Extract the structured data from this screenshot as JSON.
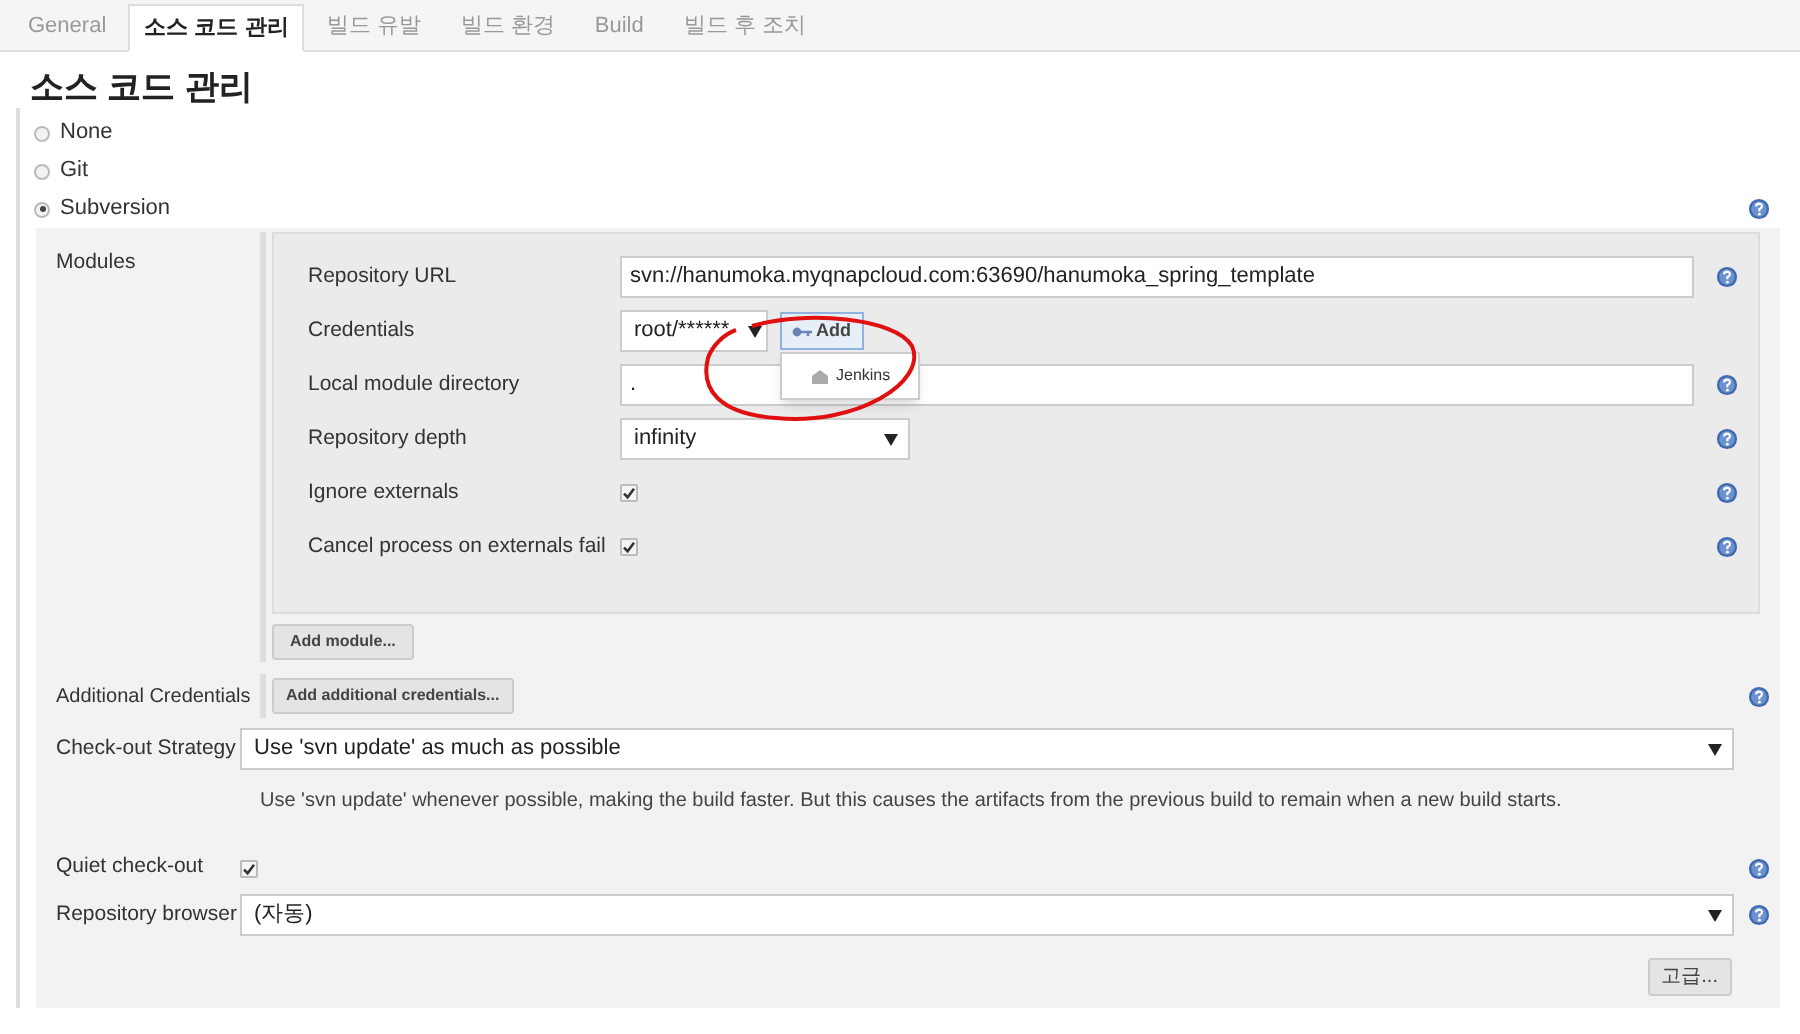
{
  "tabs": [
    {
      "label": "General",
      "selected": false
    },
    {
      "label": "소스 코드 관리",
      "selected": true
    },
    {
      "label": "빌드 유발",
      "selected": false
    },
    {
      "label": "빌드 환경",
      "selected": false
    },
    {
      "label": "Build",
      "selected": false
    },
    {
      "label": "빌드 후 조치",
      "selected": false
    }
  ],
  "heading": "소스 코드 관리",
  "scm_options": [
    {
      "label": "None",
      "selected": false,
      "help": false
    },
    {
      "label": "Git",
      "selected": false,
      "help": false
    },
    {
      "label": "Subversion",
      "selected": true,
      "help": true
    }
  ],
  "modules": {
    "label": "Modules",
    "fields": [
      {
        "kind": "text",
        "label": "Repository URL",
        "value": "svn://hanumoka.myqnapcloud.com:63690/hanumoka_spring_template",
        "help": true
      },
      {
        "kind": "credentials",
        "label": "Credentials",
        "value": "root/******",
        "add_button": "Add",
        "menu": [
          "Jenkins"
        ],
        "help": false
      },
      {
        "kind": "text",
        "label": "Local module directory",
        "value": ".",
        "help": true
      },
      {
        "kind": "select",
        "label": "Repository depth",
        "value": "infinity",
        "help": true
      },
      {
        "kind": "checkbox",
        "label": "Ignore externals",
        "checked": true,
        "help": true
      },
      {
        "kind": "checkbox",
        "label": "Cancel process on externals fail",
        "checked": true,
        "help": true
      }
    ],
    "add_button": "Add module..."
  },
  "additional_credentials": {
    "label": "Additional Credentials",
    "button": "Add additional credentials...",
    "help": true
  },
  "checkout_strategy": {
    "label": "Check-out Strategy",
    "value": "Use 'svn update' as much as possible",
    "description": "Use 'svn update' whenever possible, making the build faster. But this causes the artifacts from the previous build to remain when a new build starts.",
    "help": false
  },
  "quiet_checkout": {
    "label": "Quiet check-out",
    "checked": true,
    "help": true
  },
  "repository_browser": {
    "label": "Repository browser",
    "value": "(자동)",
    "help": true
  },
  "advanced_button": "고급..."
}
